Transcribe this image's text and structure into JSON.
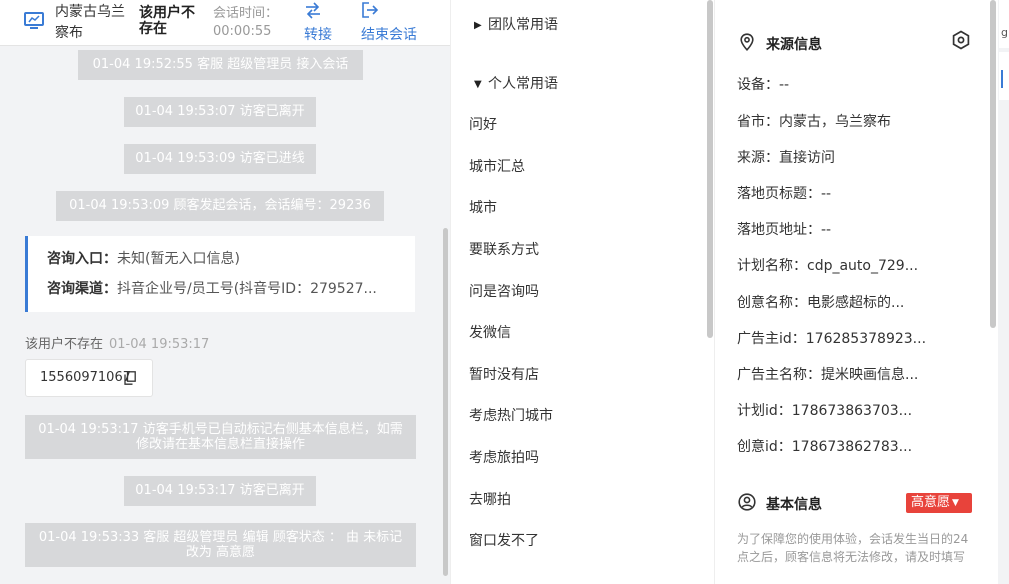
{
  "header": {
    "location": "内蒙古乌兰察布",
    "user_status": "该用户不存在",
    "session_time_label": "会话时间：",
    "session_time_value": "00:00:55",
    "transfer_label": "转接",
    "end_session_label": "结束会话"
  },
  "chat": {
    "system_messages": [
      "01-04 19:52:55 客服 超级管理员 接入会话",
      "01-04 19:53:07 访客已离开",
      "01-04 19:53:09 访客已进线",
      "01-04 19:53:09 顾客发起会话，会话编号：29236"
    ],
    "consult_card": {
      "entry_label": "咨询入口：",
      "entry_value": "未知(暂无入口信息)",
      "channel_label": "咨询渠道：",
      "channel_value": "抖音企业号/员工号(抖音号ID：279527..."
    },
    "user_line": {
      "name": "该用户不存在",
      "time": "01-04 19:53:17"
    },
    "phone": "15560971067",
    "system_messages_2": [
      "01-04 19:53:17 访客手机号已自动标记右侧基本信息栏，如需修改请在基本信息栏直接操作",
      "01-04 19:53:17 访客已离开",
      "01-04 19:53:33 客服 超级管理员 编辑 顾客状态 ： 由 未标记 改为 高意愿"
    ]
  },
  "phrases": {
    "team_group": "团队常用语",
    "personal_group": "个人常用语",
    "items": [
      "问好",
      "城市汇总",
      "城市",
      "要联系方式",
      "问是咨询吗",
      "发微信",
      "暂时没有店",
      "考虑热门城市",
      "考虑旅拍吗",
      "去哪拍",
      "窗口发不了"
    ]
  },
  "info": {
    "source_title": "来源信息",
    "rows": [
      "设备：--",
      "省市：内蒙古，乌兰察布",
      "来源：直接访问",
      "落地页标题：--",
      "落地页地址：--",
      "计划名称：cdp_auto_729...",
      "创意名称：电影感超标的...",
      "广告主id：176285378923...",
      "广告主名称：提米映画信息...",
      "计划id：178673863703...",
      "创意id：178673862783..."
    ],
    "basic_title": "基本信息",
    "intent_badge": "高意愿",
    "note": "为了保障您的使用体验，会话发生当日的24点之后，顾客信息将无法修改，请及时填写"
  },
  "edge": {
    "glyph": "g"
  },
  "colors": {
    "accent": "#3a7bd5",
    "badge_red": "#e8433b",
    "system_msg_bg": "#d7d8da",
    "chat_bg": "#f2f3f5"
  }
}
